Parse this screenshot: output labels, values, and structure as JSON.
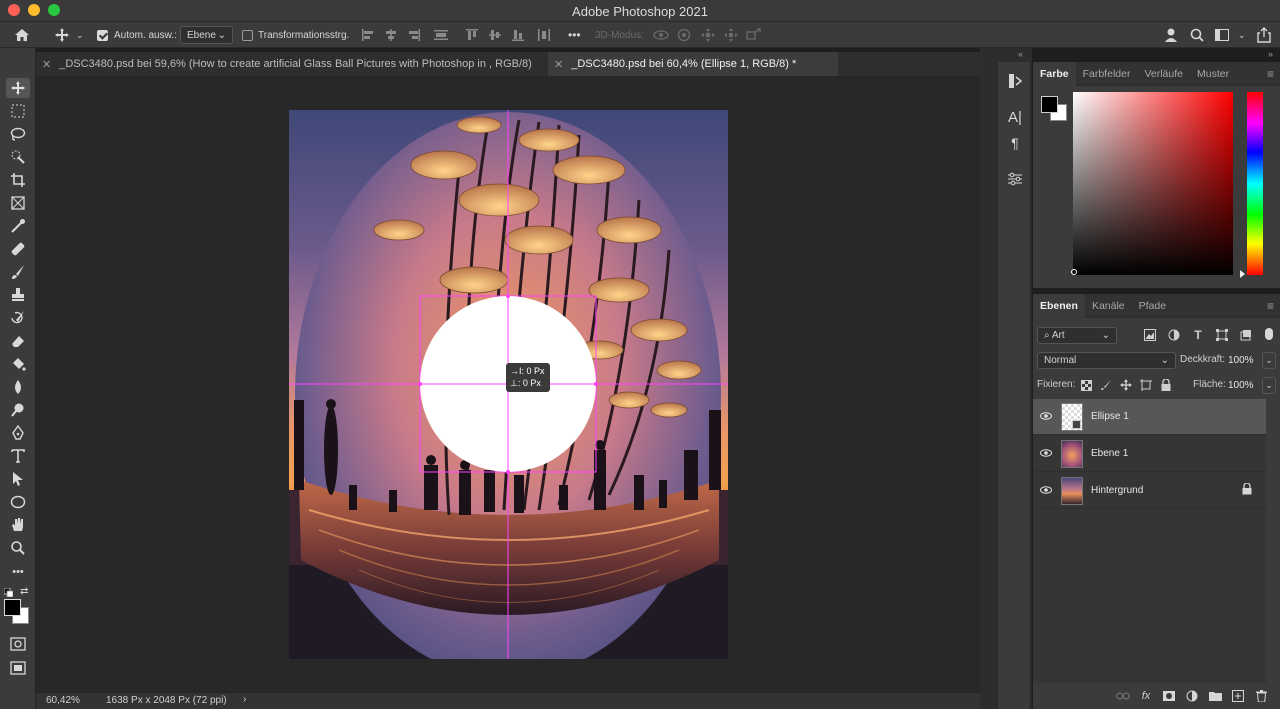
{
  "window": {
    "title": "Adobe Photoshop 2021"
  },
  "options_bar": {
    "auto_select_label": "Autom. ausw.:",
    "auto_select_checked": true,
    "target_value": "Ebene",
    "transform_controls_label": "Transformationsstrg.",
    "transform_controls_checked": false,
    "three_d_mode_label": "3D-Modus:",
    "more": "•••"
  },
  "tabs": [
    {
      "label": "_DSC3480.psd bei 59,6% (How to create artificial Glass Ball Pictures with Photoshop in , RGB/8)",
      "active": false
    },
    {
      "label": "_DSC3480.psd bei 60,4% (Ellipse 1, RGB/8) *",
      "active": true
    }
  ],
  "canvas": {
    "hud_line1": "→I: 0 Px",
    "hud_line2": "⊥: 0 Px"
  },
  "status": {
    "zoom": "60,42%",
    "doc_size": "1638 Px x 2048 Px (72 ppi)",
    "arrow": "›"
  },
  "color_panel": {
    "tabs": [
      "Farbe",
      "Farbfelder",
      "Verläufe",
      "Muster"
    ],
    "active_tab": "Farbe",
    "foreground": "#000000",
    "background": "#ffffff",
    "hue_color": "#ff0000"
  },
  "layers_panel": {
    "tabs": [
      "Ebenen",
      "Kanäle",
      "Pfade"
    ],
    "active_tab": "Ebenen",
    "filter_label": "Art",
    "blend_mode": "Normal",
    "opacity_label": "Deckkraft:",
    "opacity_value": "100%",
    "lock_label": "Fixieren:",
    "fill_label": "Fläche:",
    "fill_value": "100%",
    "layers": [
      {
        "name": "Ellipse 1",
        "selected": true,
        "locked": false
      },
      {
        "name": "Ebene 1",
        "selected": false,
        "locked": false
      },
      {
        "name": "Hintergrund",
        "selected": false,
        "locked": true
      }
    ]
  }
}
